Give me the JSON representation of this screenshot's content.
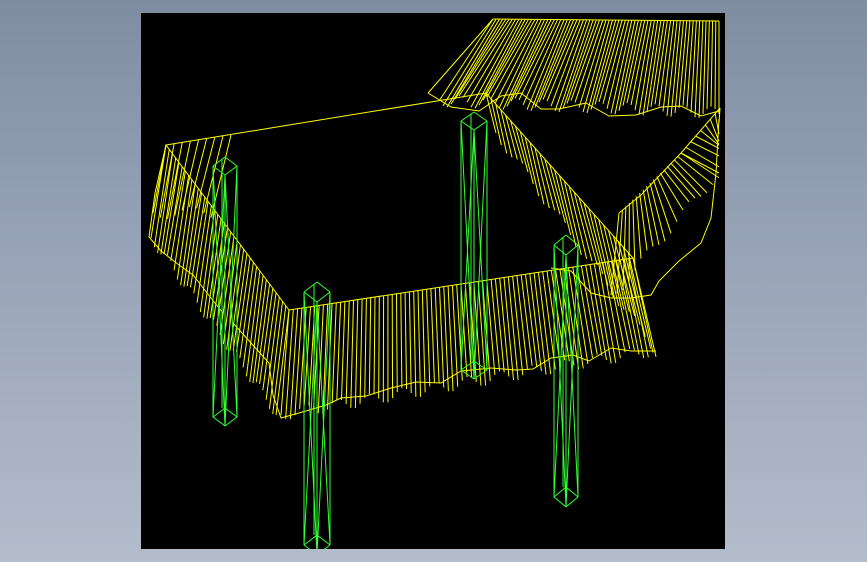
{
  "viewport": {
    "background": "#000000",
    "colors": {
      "tablecloth": "#ffff00",
      "legs": "#33ff33",
      "backdrop": "#8a96ab"
    }
  },
  "scene": {
    "objects": [
      "tablecloth-wireframe",
      "table-leg",
      "table-leg",
      "table-leg",
      "table-leg",
      "background-drape-wireframe"
    ]
  }
}
